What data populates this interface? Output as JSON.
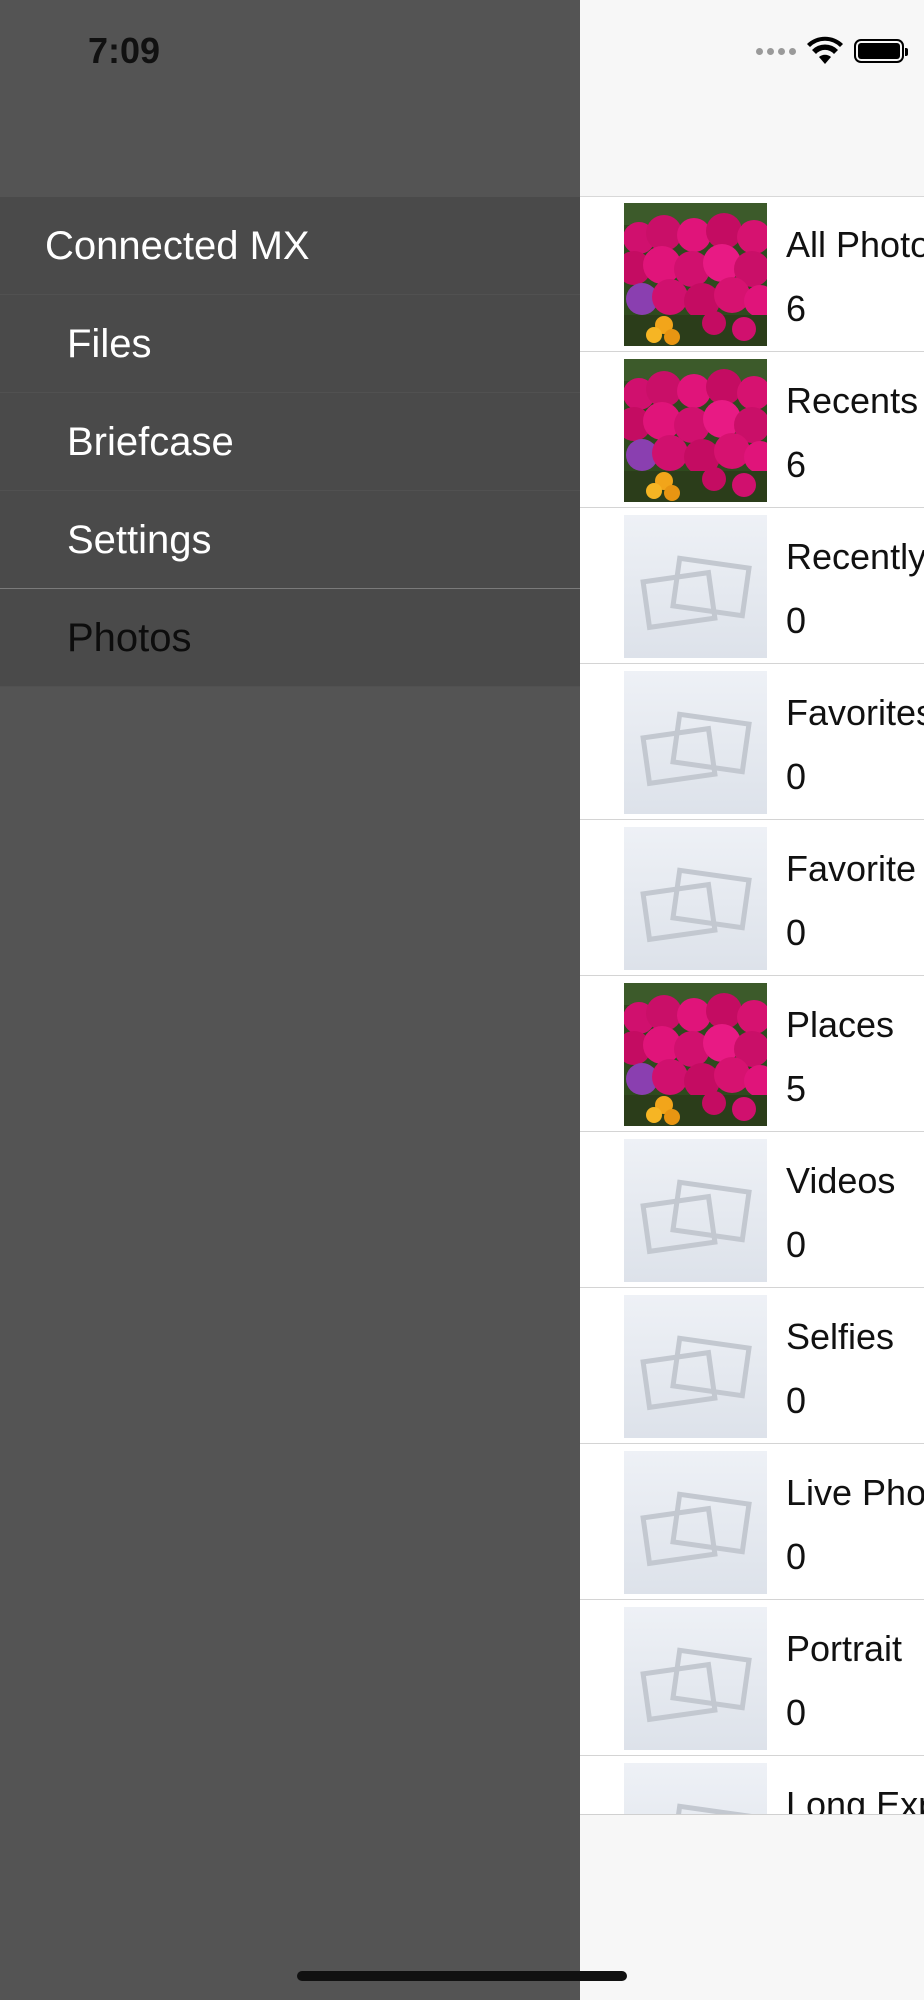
{
  "status_bar": {
    "time": "7:09",
    "icons": [
      "cellular-dots-icon",
      "wifi-icon",
      "battery-icon"
    ]
  },
  "drawer": {
    "header": "Connected MX",
    "items": [
      {
        "label": "Files"
      },
      {
        "label": "Briefcase"
      },
      {
        "label": "Settings"
      },
      {
        "label": "Photos"
      }
    ]
  },
  "albums": [
    {
      "title": "All Photos",
      "count": "6",
      "thumb": "flowers"
    },
    {
      "title": "Recents",
      "count": "6",
      "thumb": "flowers"
    },
    {
      "title": "Recently Deleted",
      "count": "0",
      "thumb": "placeholder"
    },
    {
      "title": "Favorites",
      "count": "0",
      "thumb": "placeholder"
    },
    {
      "title": "Favorite",
      "count": "0",
      "thumb": "placeholder"
    },
    {
      "title": "Places",
      "count": "5",
      "thumb": "flowers"
    },
    {
      "title": "Videos",
      "count": "0",
      "thumb": "placeholder"
    },
    {
      "title": "Selfies",
      "count": "0",
      "thumb": "placeholder"
    },
    {
      "title": "Live Photos",
      "count": "0",
      "thumb": "placeholder"
    },
    {
      "title": "Portrait",
      "count": "0",
      "thumb": "placeholder"
    },
    {
      "title": "Long Exposure",
      "count": "",
      "thumb": "placeholder"
    }
  ],
  "colors": {
    "drawer_bg": "#545454",
    "menu_item_bg": "#4a4a4a",
    "flower_magenta": "#d0106e",
    "placeholder_bg": "#e4e8ef"
  }
}
